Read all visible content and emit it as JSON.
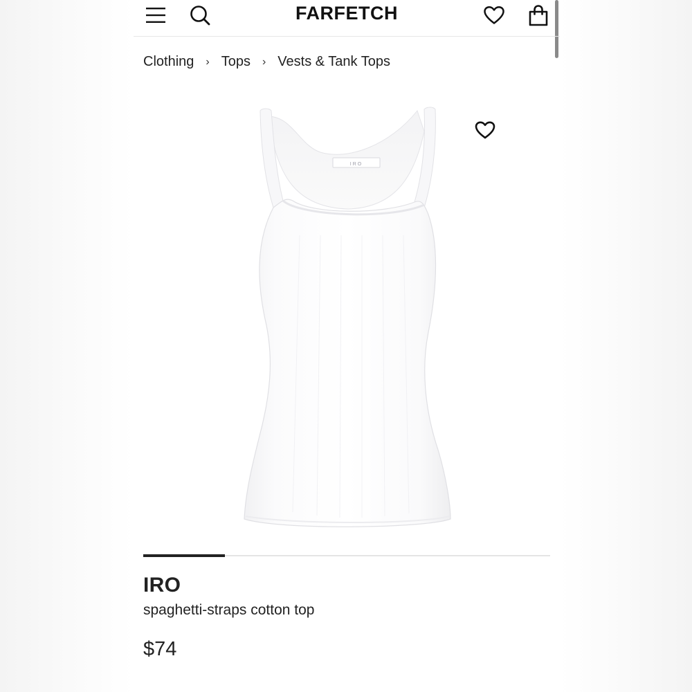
{
  "header": {
    "logo_text": "FARFETCH",
    "icons": {
      "menu": "hamburger-menu-icon",
      "search": "search-icon",
      "wishlist": "heart-icon",
      "bag": "shopping-bag-icon"
    }
  },
  "breadcrumb": {
    "items": [
      {
        "label": "Clothing"
      },
      {
        "label": "Tops"
      },
      {
        "label": "Vests & Tank Tops"
      }
    ],
    "separator": "›"
  },
  "product": {
    "brand": "IRO",
    "name": "spaghetti-straps cotton top",
    "price": "$74",
    "label_text": "IRO",
    "image_gallery_progress": 0.2
  },
  "colors": {
    "text": "#222222",
    "background": "#ffffff",
    "progress_fill": "#222222",
    "progress_track": "#e4e4e4"
  }
}
